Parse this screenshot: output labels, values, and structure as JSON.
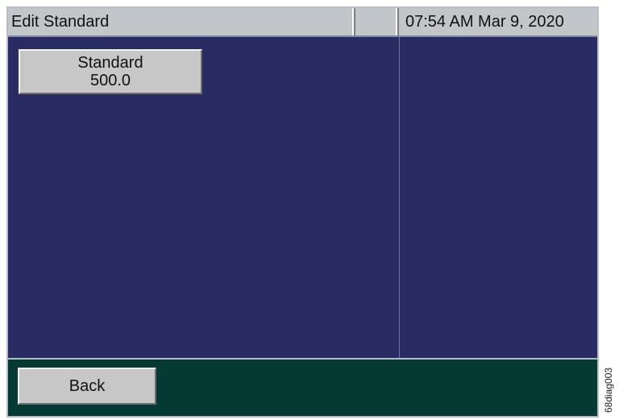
{
  "header": {
    "title": "Edit Standard",
    "status": "",
    "datetime": "07:54 AM Mar 9, 2020"
  },
  "main": {
    "standard_button": {
      "label": "Standard",
      "value": "500.0"
    }
  },
  "footer": {
    "back_label": "Back"
  },
  "figure_id": "68diag003",
  "colors": {
    "titlebar_bg": "#c3c6c9",
    "main_bg": "#282c62",
    "footer_bg": "#053a34",
    "button_bg": "#c7c7c7"
  }
}
